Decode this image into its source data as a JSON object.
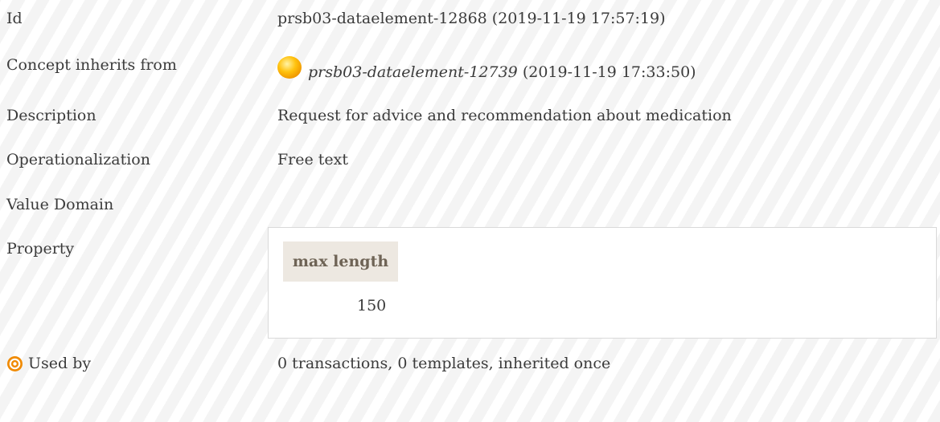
{
  "rows": {
    "id": {
      "label": "Id",
      "value": "prsb03-dataelement-12868 (2019-11-19 17:57:19)"
    },
    "inherits": {
      "label": "Concept inherits from",
      "ref_id": "prsb03-dataelement-12739",
      "ref_timestamp": "(2019-11-19 17:33:50)",
      "icon": "yellow-sun-icon"
    },
    "description": {
      "label": "Description",
      "value": "Request for advice and recommendation about medication"
    },
    "operationalization": {
      "label": "Operationalization",
      "value": "Free text"
    },
    "value_domain": {
      "label": "Value Domain",
      "value": ""
    },
    "property": {
      "label": "Property",
      "header": "max length",
      "value": "150"
    },
    "used_by": {
      "label": "Used by",
      "icon": "target-icon",
      "value": "0 transactions, 0 templates, inherited once"
    }
  },
  "colors": {
    "text": "#3b3b3b",
    "stripe_light": "#ffffff",
    "stripe_dark": "#f4f4f4",
    "property_header_bg": "#ede8e1",
    "property_header_text": "#6e6355",
    "target_icon": "#f08a00",
    "sun_icon": "#ffc20e"
  }
}
